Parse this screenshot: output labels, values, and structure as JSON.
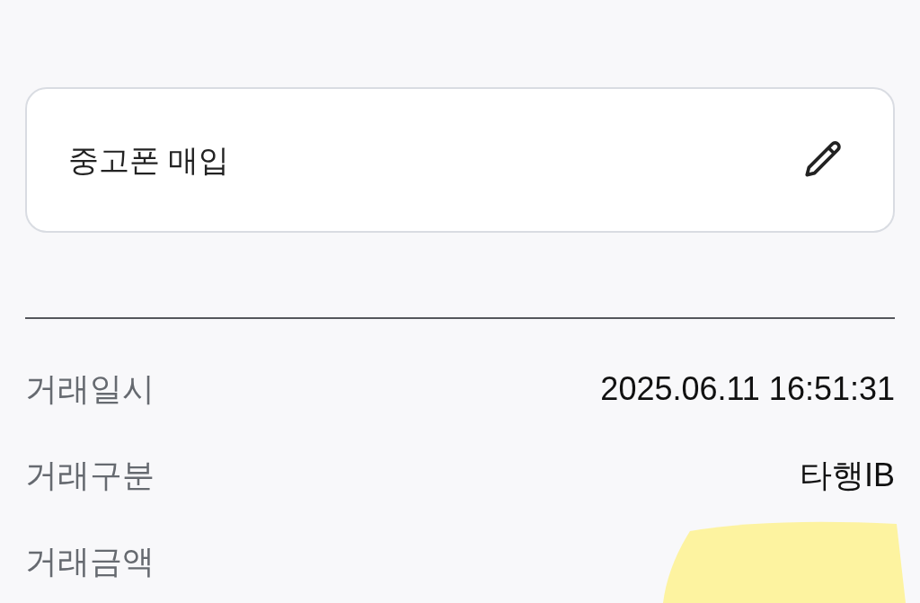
{
  "memo_card": {
    "text": "중고폰 매입"
  },
  "details": [
    {
      "label": "거래일시",
      "value": "2025.06.11 16:51:31",
      "redacted": false
    },
    {
      "label": "거래구분",
      "value": "타행IB",
      "redacted": false
    },
    {
      "label": "거래금액",
      "redacted": true
    }
  ]
}
